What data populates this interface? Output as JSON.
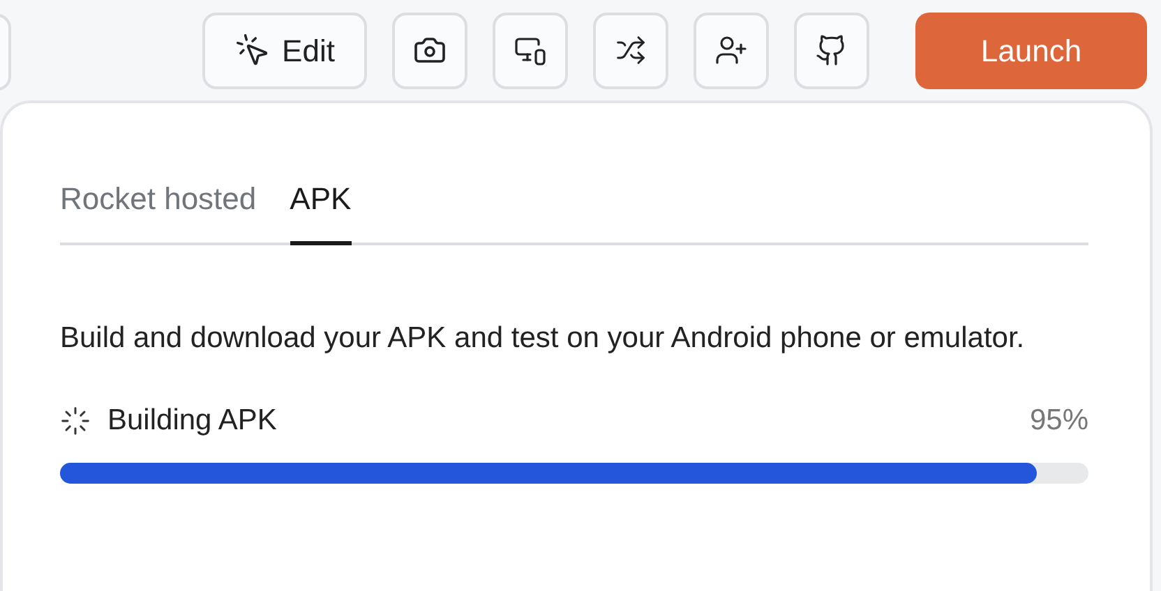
{
  "toolbar": {
    "edit_button": "Edit",
    "launch_button": "Launch"
  },
  "tabs": [
    {
      "label": "Rocket hosted",
      "selected": false
    },
    {
      "label": "APK",
      "selected": true
    }
  ],
  "description": "Build and download your APK and test on your Android phone or emulator.",
  "progress": {
    "label": "Building APK",
    "reading": "95%",
    "level": 0.95
  }
}
